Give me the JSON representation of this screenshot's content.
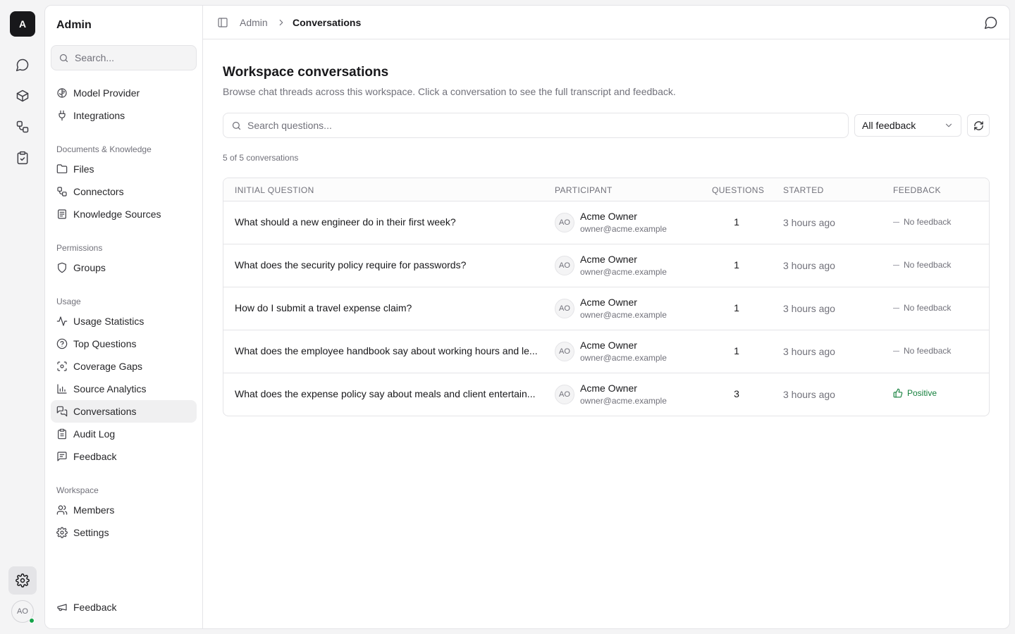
{
  "rail": {
    "logo": "A",
    "avatar": "AO",
    "status_color": "#16a34a"
  },
  "sidebar": {
    "title": "Admin",
    "search_placeholder": "Search...",
    "top_items": [
      {
        "label": "Model Provider",
        "icon": "brain-icon"
      },
      {
        "label": "Integrations",
        "icon": "plug-icon"
      }
    ],
    "sections": [
      {
        "label": "Documents & Knowledge",
        "items": [
          {
            "label": "Files",
            "icon": "folder-icon"
          },
          {
            "label": "Connectors",
            "icon": "connectors-icon"
          },
          {
            "label": "Knowledge Sources",
            "icon": "book-icon"
          }
        ]
      },
      {
        "label": "Permissions",
        "items": [
          {
            "label": "Groups",
            "icon": "shield-icon"
          }
        ]
      },
      {
        "label": "Usage",
        "items": [
          {
            "label": "Usage Statistics",
            "icon": "activity-icon"
          },
          {
            "label": "Top Questions",
            "icon": "help-circle-icon"
          },
          {
            "label": "Coverage Gaps",
            "icon": "scan-icon"
          },
          {
            "label": "Source Analytics",
            "icon": "bar-chart-icon"
          },
          {
            "label": "Conversations",
            "icon": "messages-icon",
            "active": true
          },
          {
            "label": "Audit Log",
            "icon": "clipboard-icon"
          },
          {
            "label": "Feedback",
            "icon": "message-square-icon"
          }
        ]
      },
      {
        "label": "Workspace",
        "items": [
          {
            "label": "Members",
            "icon": "users-icon"
          },
          {
            "label": "Settings",
            "icon": "gear-icon"
          }
        ]
      }
    ],
    "footer_item": {
      "label": "Feedback",
      "icon": "megaphone-icon"
    }
  },
  "header": {
    "breadcrumb_root": "Admin",
    "breadcrumb_current": "Conversations"
  },
  "main": {
    "title": "Workspace conversations",
    "subtitle": "Browse chat threads across this workspace. Click a conversation to see the full transcript and feedback.",
    "search_placeholder": "Search questions...",
    "feedback_filter": "All feedback",
    "count_label": "5 of 5 conversations"
  },
  "table": {
    "columns": [
      "Initial question",
      "Participant",
      "Questions",
      "Started",
      "Feedback"
    ],
    "rows": [
      {
        "question": "What should a new engineer do in their first week?",
        "initials": "AO",
        "name": "Acme Owner",
        "email": "owner@acme.example",
        "questions": "1",
        "started": "3 hours ago",
        "feedback": "No feedback",
        "feedback_type": "none"
      },
      {
        "question": "What does the security policy require for passwords?",
        "initials": "AO",
        "name": "Acme Owner",
        "email": "owner@acme.example",
        "questions": "1",
        "started": "3 hours ago",
        "feedback": "No feedback",
        "feedback_type": "none"
      },
      {
        "question": "How do I submit a travel expense claim?",
        "initials": "AO",
        "name": "Acme Owner",
        "email": "owner@acme.example",
        "questions": "1",
        "started": "3 hours ago",
        "feedback": "No feedback",
        "feedback_type": "none"
      },
      {
        "question": "What does the employee handbook say about working hours and le...",
        "initials": "AO",
        "name": "Acme Owner",
        "email": "owner@acme.example",
        "questions": "1",
        "started": "3 hours ago",
        "feedback": "No feedback",
        "feedback_type": "none"
      },
      {
        "question": "What does the expense policy say about meals and client entertain...",
        "initials": "AO",
        "name": "Acme Owner",
        "email": "owner@acme.example",
        "questions": "3",
        "started": "3 hours ago",
        "feedback": "Positive",
        "feedback_type": "positive"
      }
    ]
  },
  "colors": {
    "positive": "#15803d",
    "active_item_bg": "#f0f0f1"
  }
}
